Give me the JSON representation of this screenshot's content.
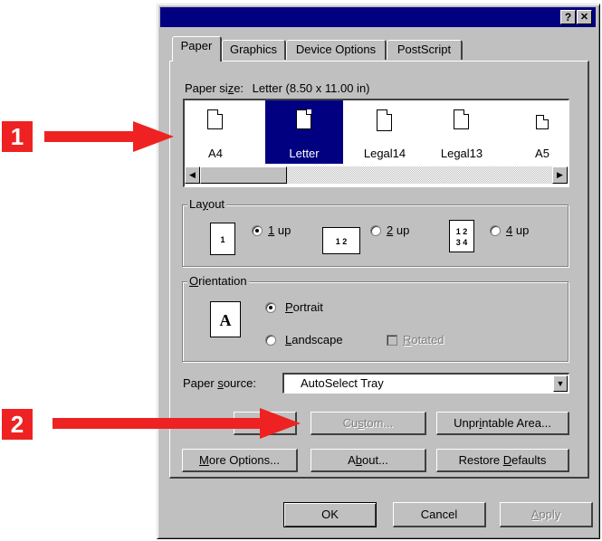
{
  "window": {
    "title": "",
    "help_label": "?",
    "close_label": "✕"
  },
  "tabs": [
    {
      "label": "Paper",
      "active": true
    },
    {
      "label": "Graphics",
      "active": false
    },
    {
      "label": "Device Options",
      "active": false
    },
    {
      "label": "PostScript",
      "active": false
    }
  ],
  "paper_size": {
    "label_pre": "Paper si",
    "label_u": "z",
    "label_post": "e:",
    "value": "Letter (8.50 x 11.00 in)",
    "items": [
      "A4",
      "Letter",
      "Legal14",
      "Legal13",
      "A5"
    ],
    "selected": "Letter"
  },
  "layout": {
    "label_pre": "La",
    "label_u": "y",
    "label_post": "out",
    "options": [
      {
        "u": "1",
        "rest": " up",
        "icon": "1",
        "selected": true
      },
      {
        "u": "2",
        "rest": " up",
        "icon": "1 2",
        "selected": false
      },
      {
        "u": "4",
        "rest": " up",
        "icon_top": "1 2",
        "icon_bottom": "3 4",
        "selected": false
      }
    ]
  },
  "orientation": {
    "label_u": "O",
    "label_post": "rientation",
    "preview_letter": "A",
    "portrait": {
      "u": "P",
      "rest": "ortrait",
      "selected": true
    },
    "landscape": {
      "u": "L",
      "rest": "andscape",
      "selected": false
    },
    "rotated": {
      "u": "R",
      "rest": "otated",
      "checked": false
    }
  },
  "paper_source": {
    "label_pre": "Paper ",
    "label_u": "s",
    "label_post": "ource:",
    "value": "AutoSelect Tray"
  },
  "buttons": {
    "custom": {
      "pre": "Cu",
      "u": "s",
      "post": "tom..."
    },
    "unprintable": {
      "pre": "Unpr",
      "u": "i",
      "post": "ntable Area..."
    },
    "more_options": {
      "u": "M",
      "post": "ore Options..."
    },
    "about": {
      "pre": "A",
      "u": "b",
      "post": "out..."
    },
    "restore": {
      "pre": "Restore ",
      "u": "D",
      "post": "efaults"
    },
    "ok": "OK",
    "cancel": "Cancel",
    "apply": {
      "u": "A",
      "post": "pply"
    }
  },
  "callouts": [
    "1",
    "2"
  ],
  "colors": {
    "accent": "#000080",
    "callout": "#ee2222",
    "face": "#c0c0c0"
  }
}
